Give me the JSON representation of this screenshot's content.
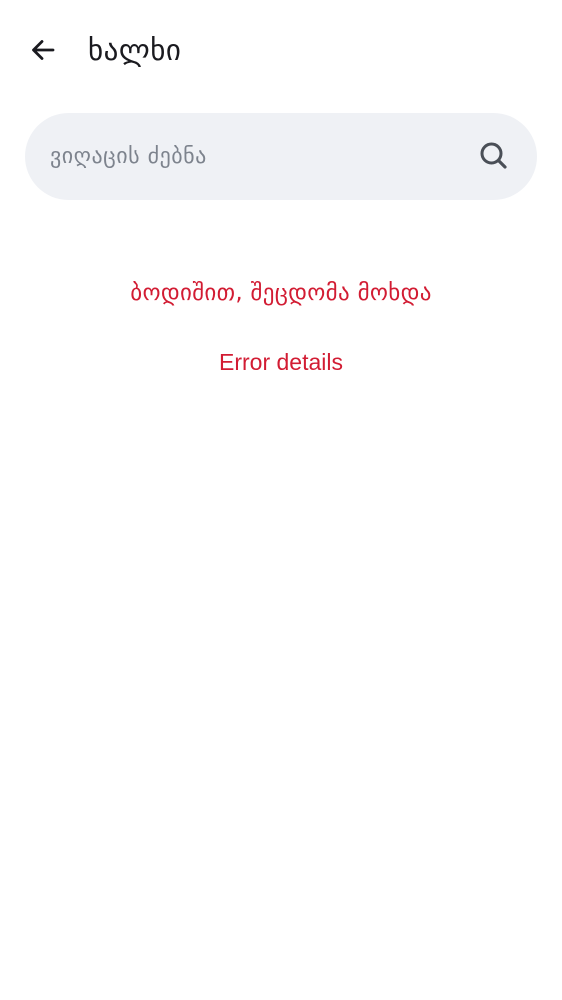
{
  "header": {
    "back_icon": "arrow-left-icon",
    "title": "ხალხი"
  },
  "search": {
    "placeholder": "ვიღაცის ძებნა",
    "value": "",
    "icon": "search-icon"
  },
  "error": {
    "message": "ბოდიშით, შეცდომა მოხდა",
    "details_link": "Error details",
    "color": "#d21c33"
  },
  "colors": {
    "background": "#ffffff",
    "search_background": "#eff1f5",
    "title_text": "#1a1a1f",
    "placeholder_text": "#7d838d"
  }
}
